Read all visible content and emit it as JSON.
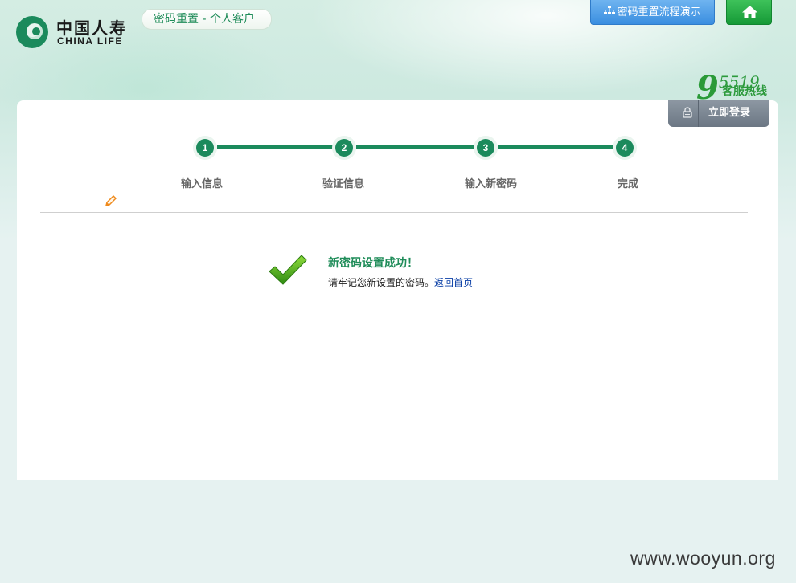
{
  "header": {
    "logo_cn": "中国人寿",
    "logo_en": "CHINA LIFE",
    "page_title": "密码重置 - 个人客户",
    "demo_button": "密码重置流程演示",
    "home_icon": "home-icon",
    "hotline_number": "95519",
    "hotline_label": "客服热线",
    "login_button": "立即登录"
  },
  "steps": [
    {
      "num": "1",
      "label": "输入信息"
    },
    {
      "num": "2",
      "label": "验证信息"
    },
    {
      "num": "3",
      "label": "输入新密码"
    },
    {
      "num": "4",
      "label": "完成"
    }
  ],
  "result": {
    "title": "新密码设置成功！",
    "message": "请牢记您新设置的密码。",
    "return_link": "返回首页"
  },
  "watermark": "www.wooyun.org",
  "colors": {
    "brand_green": "#1b8a5c",
    "title_green": "#1f8c59",
    "demo_blue": "#3a8ee0",
    "home_green": "#169a37",
    "login_gray": "#6c7784"
  }
}
